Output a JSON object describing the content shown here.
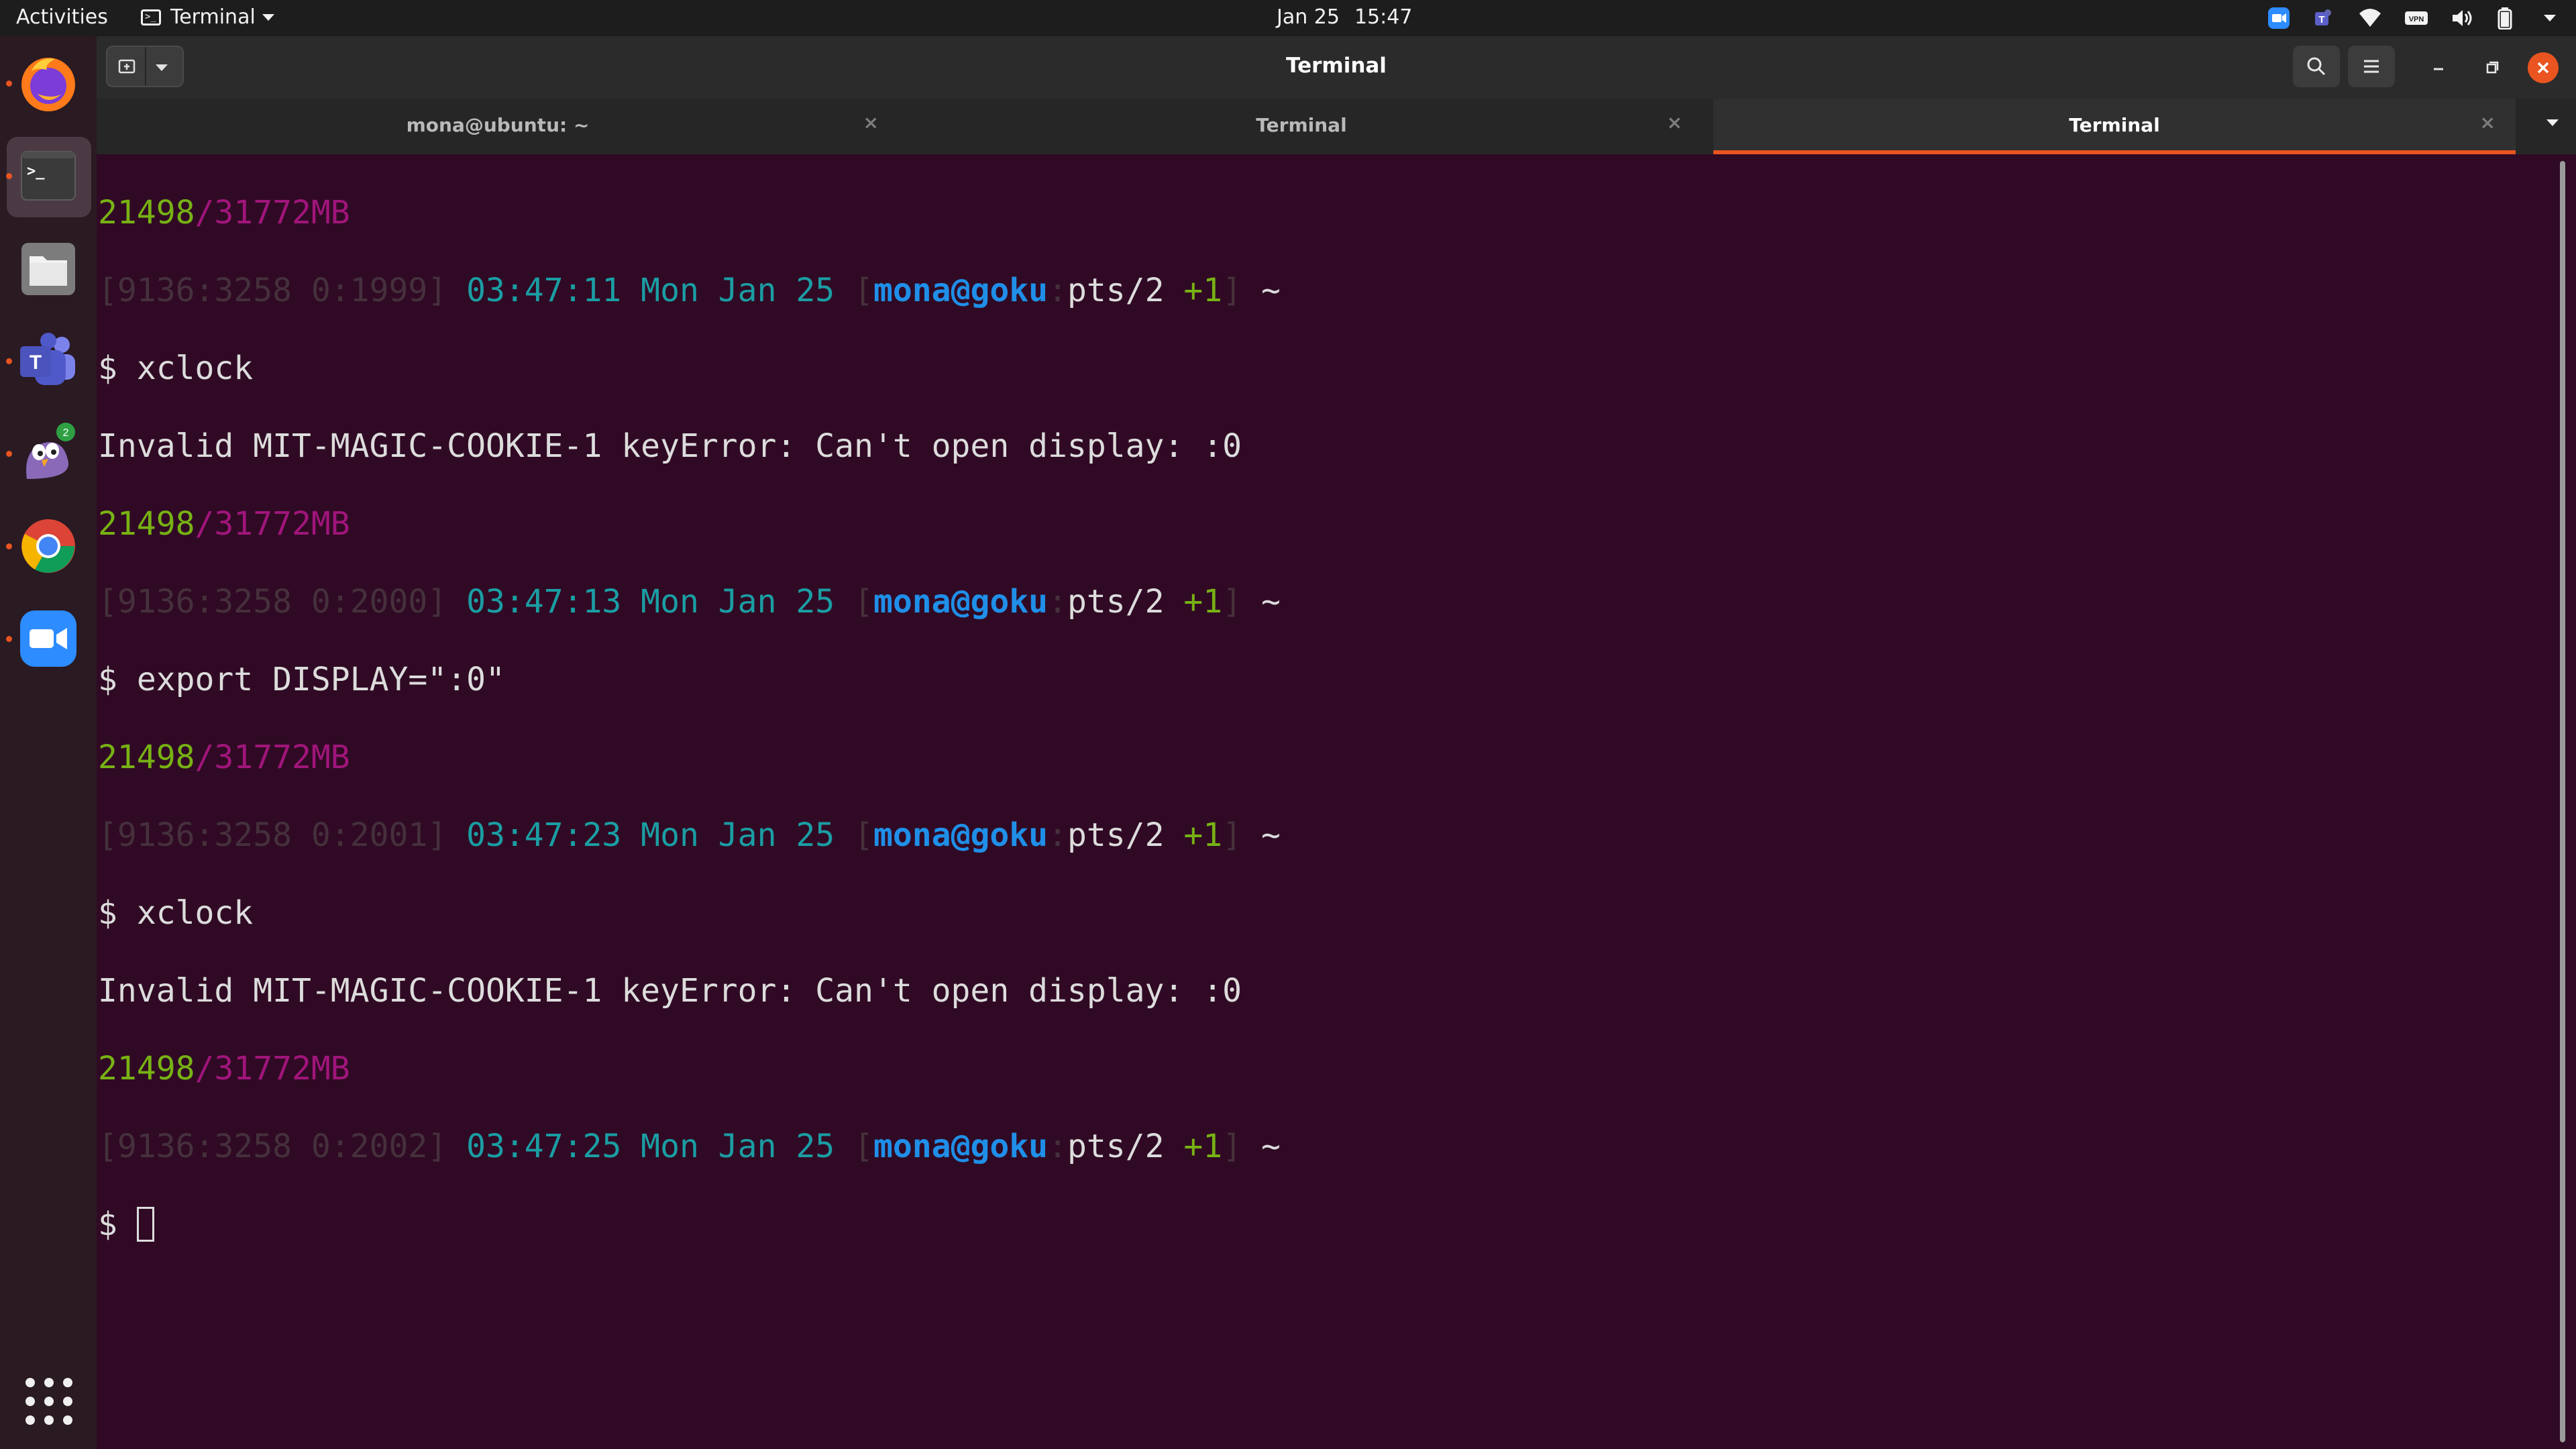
{
  "topbar": {
    "activities": "Activities",
    "app_name": "Terminal",
    "date": "Jan 25",
    "time": "15:47",
    "tray_icons": [
      "zoom-tray-icon",
      "teams-tray-icon",
      "wifi-icon",
      "vpn-icon",
      "volume-icon",
      "battery-icon",
      "system-menu-caret-icon"
    ],
    "vpn_label": "VPN"
  },
  "dock": {
    "items": [
      "firefox",
      "terminal",
      "files",
      "teams",
      "pidgin",
      "chrome",
      "zoom"
    ],
    "pidgin_badge": "2",
    "terminal_glyph": ">_"
  },
  "window": {
    "title": "Terminal",
    "tabs": [
      {
        "label": "mona@ubuntu: ~",
        "active": false
      },
      {
        "label": "Terminal",
        "active": false
      },
      {
        "label": "Terminal",
        "active": true
      }
    ],
    "close_glyph": "×"
  },
  "terminal": {
    "mem_used": "21498",
    "mem_total": "31772MB",
    "prompt_host": "mona@goku",
    "tty": "pts/2",
    "jobs": "+1",
    "cwd": "~",
    "ps1": "$",
    "cmd_xclock": "xclock",
    "cmd_export": "export DISPLAY=\":0\"",
    "error": "Invalid MIT-MAGIC-COOKIE-1 keyError: Can't open display: :0",
    "prompts": [
      {
        "counters": "9136:3258 0:1999",
        "time": "03:47:11 Mon Jan 25"
      },
      {
        "counters": "9136:3258 0:2000",
        "time": "03:47:13 Mon Jan 25"
      },
      {
        "counters": "9136:3258 0:2001",
        "time": "03:47:23 Mon Jan 25"
      },
      {
        "counters": "9136:3258 0:2002",
        "time": "03:47:25 Mon Jan 25"
      }
    ]
  },
  "colors": {
    "background": "#300a24",
    "accent": "#e95420",
    "green": "#77b214",
    "magenta": "#a0157b",
    "cyan": "#1a9ea4",
    "blue": "#1f8fe8"
  }
}
